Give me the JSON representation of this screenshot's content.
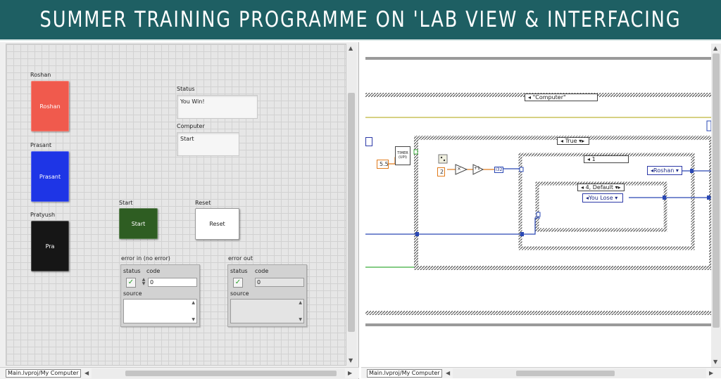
{
  "banner": {
    "title": "SUMMER TRAINING PROGRAMME ON 'LAB VIEW & INTERFACING"
  },
  "front_panel": {
    "buttons": [
      {
        "label": "Roshan",
        "caption": "Roshan",
        "color": "#f05a4d"
      },
      {
        "label": "Prasant",
        "caption": "Prasant",
        "color": "#1e35e6"
      },
      {
        "label": "Pratyush",
        "caption": "Pra",
        "color": "#161616"
      }
    ],
    "status": {
      "label": "Status",
      "value": "You Win!"
    },
    "computer": {
      "label": "Computer",
      "value": "Start"
    },
    "start_button": {
      "label": "Start",
      "caption": "Start",
      "color": "#2e5d22"
    },
    "reset_button": {
      "label": "Reset",
      "caption": "Reset"
    },
    "error_in": {
      "title": "error in (no error)",
      "status_label": "status",
      "code_label": "code",
      "code_value": "0",
      "source_label": "source"
    },
    "error_out": {
      "title": "error out",
      "status_label": "status",
      "code_label": "code",
      "code_value": "0",
      "source_label": "source"
    },
    "path": "Main.lvproj/My Computer"
  },
  "block_diagram": {
    "outer_case": "\"Computer\"",
    "true_case": "True",
    "timer_label": "TIMER (UPI)",
    "timer_const": "5.5",
    "num_const": "2",
    "increment_label": "+1",
    "multiply_label": "×",
    "convert_label": "I32",
    "case_one": "1",
    "case_default": "4, Default",
    "enum_roshan": "Roshan",
    "enum_you_lose": "You Lose",
    "path": "Main.lvproj/My Computer"
  },
  "colors": {
    "banner": "#1e5f63",
    "wire_blue": "#2a48b4",
    "wire_orange": "#e07a1b",
    "wire_green": "#3cae3c"
  }
}
